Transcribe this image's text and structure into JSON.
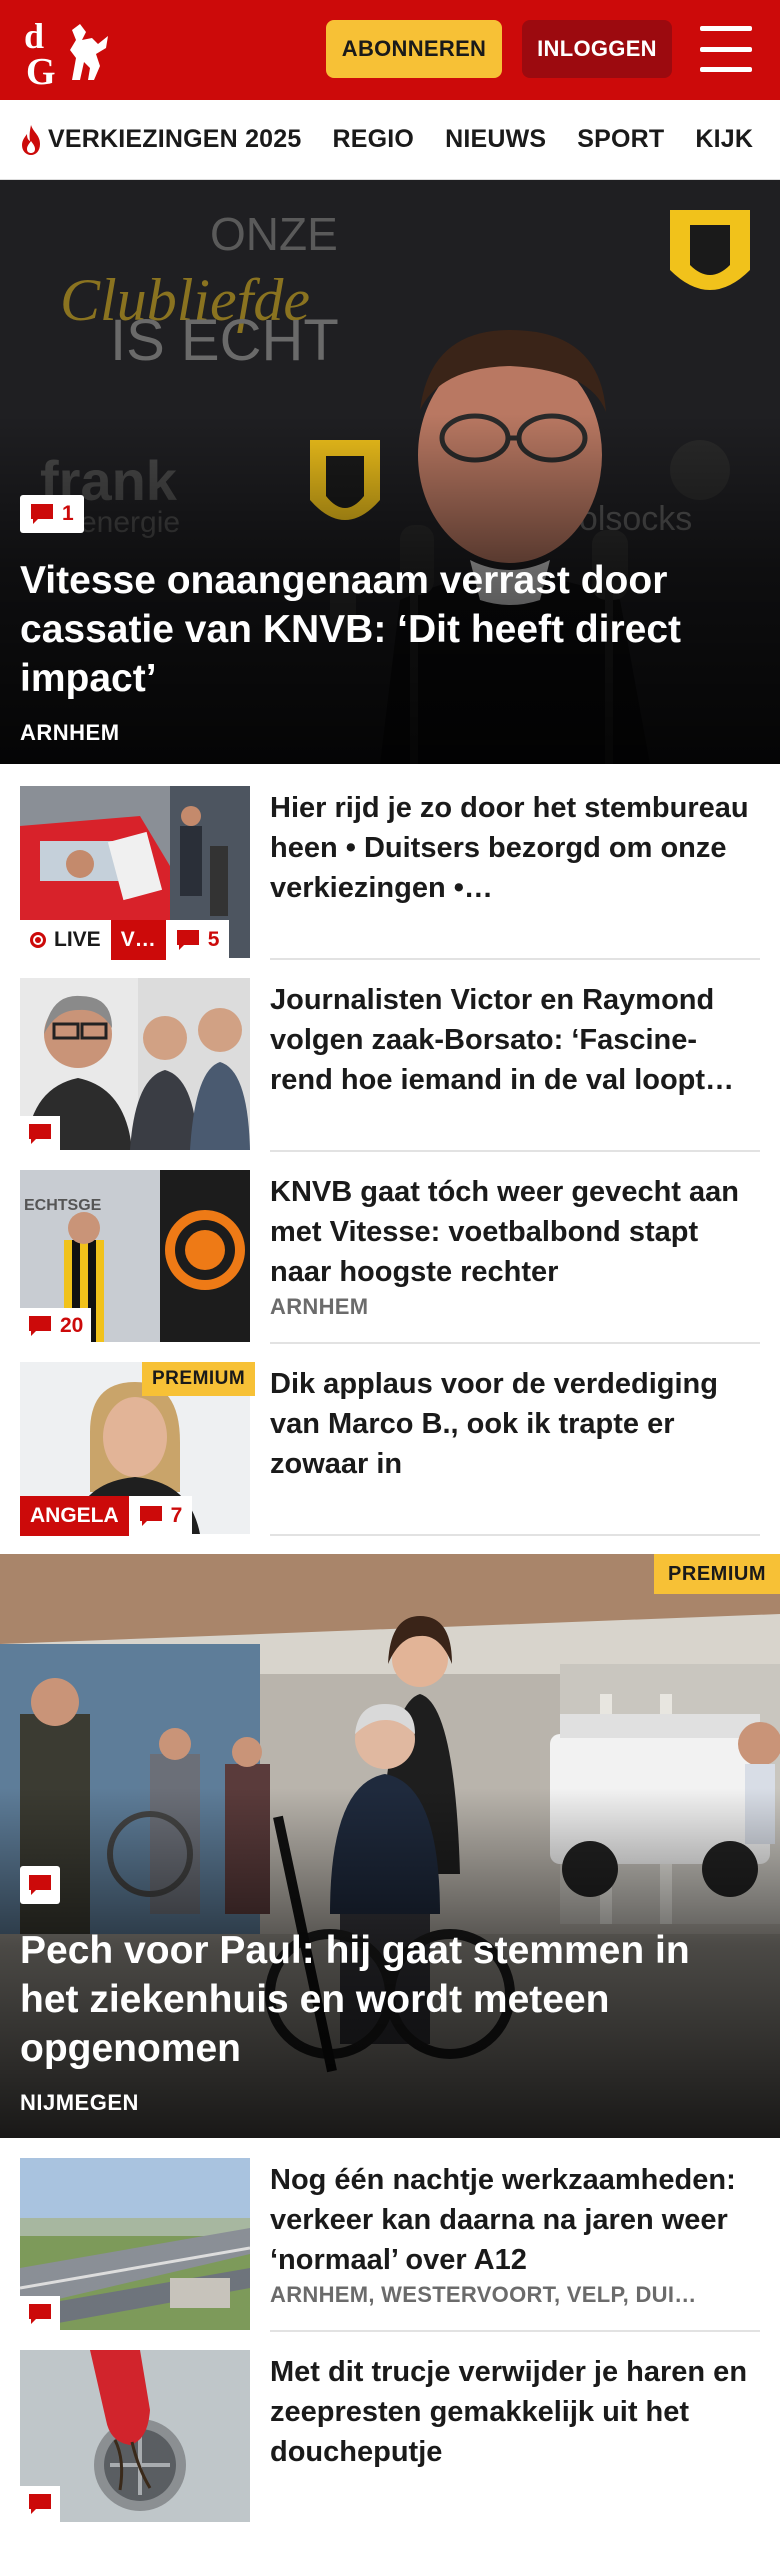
{
  "header": {
    "logo_label": "dG",
    "subscribe_label": "ABONNEREN",
    "login_label": "INLOGGEN",
    "brand_color": "#cc0a0a",
    "subscribe_color": "#f7c136",
    "login_color": "#9c0a0f"
  },
  "nav": {
    "items": [
      {
        "label": "VERKIEZINGEN 2025",
        "icon": "flame-icon"
      },
      {
        "label": "REGIO"
      },
      {
        "label": "NIEUWS"
      },
      {
        "label": "SPORT"
      },
      {
        "label": "KIJK"
      }
    ]
  },
  "hero1": {
    "comments": "1",
    "title": "Vitesse onaangenaam verrast door cassatie van KNVB: ‘Dit heeft direct impact’",
    "location": "ARNHEM",
    "backdrop_text": [
      "ONZE",
      "Clubliefde",
      "IS ECHT",
      "frank",
      "energie",
      "oolsocks"
    ]
  },
  "articles": [
    {
      "title": "Hier rijd je zo door het stembureau heen • Duitsers bezorgd om onze verkiezingen •…",
      "live_label": "LIVE",
      "tag": "V…",
      "comments": "5"
    },
    {
      "title": "Journalisten Victor en Raymond volgen zaak-Borsato: ‘Fascine­rend hoe iemand in de val loopt…",
      "comments": ""
    },
    {
      "title": "KNVB gaat tóch weer gevecht aan met Vitesse: voetbalbond stapt naar hoogste rechter",
      "location": "ARNHEM",
      "comments": "20"
    },
    {
      "title": "Dik applaus voor de verdediging van Marco B., ook ik trapte er zowaar in",
      "premium_label": "PREMIUM",
      "author_tag": "ANGELA",
      "comments": "7"
    }
  ],
  "hero2": {
    "premium_label": "PREMIUM",
    "title": "Pech voor Paul: hij gaat stemmen in het ziekenhuis en wordt meteen opgenomen",
    "location": "NIJMEGEN"
  },
  "articles2": [
    {
      "title": "Nog één nachtje werkzaamhe­den: verkeer kan daarna na jaren weer ‘normaal’ over A12",
      "location": "ARNHEM, WESTERVOORT, VELP, DUI…"
    },
    {
      "title": "Met dit trucje verwijder je haren en zeepresten gemakkelijk uit het doucheputje"
    }
  ]
}
